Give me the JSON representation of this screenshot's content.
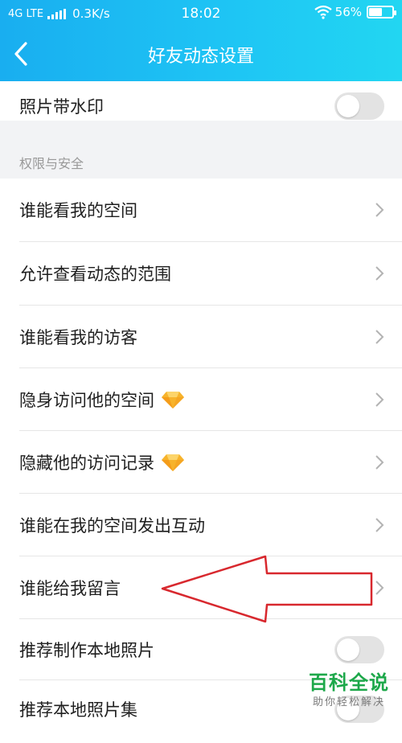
{
  "status_bar": {
    "network": "4G LTE",
    "speed": "0.3K/s",
    "time": "18:02",
    "battery": "56%",
    "battery_level": 0.56
  },
  "nav": {
    "title": "好友动态设置"
  },
  "rows_top": [
    {
      "label": "照片带水印",
      "control": "toggle",
      "on": false
    }
  ],
  "section": {
    "title": "权限与安全"
  },
  "rows": [
    {
      "label": "谁能看我的空间",
      "control": "chevron"
    },
    {
      "label": "允许查看动态的范围",
      "control": "chevron"
    },
    {
      "label": "谁能看我的访客",
      "control": "chevron"
    },
    {
      "label": "隐身访问他的空间",
      "control": "chevron",
      "badge": "diamond-icon"
    },
    {
      "label": "隐藏他的访问记录",
      "control": "chevron",
      "badge": "diamond-icon"
    },
    {
      "label": "谁能在我的空间发出互动",
      "control": "chevron"
    },
    {
      "label": "谁能给我留言",
      "control": "chevron"
    },
    {
      "label": "推荐制作本地照片",
      "control": "toggle",
      "on": false
    },
    {
      "label": "推荐本地照片集",
      "control": "toggle",
      "on": false
    }
  ],
  "watermark": {
    "main": "百科全说",
    "sub": "助你轻松解决"
  },
  "colors": {
    "accent": "#1ab8f2",
    "annotation_arrow": "#d8282e"
  }
}
